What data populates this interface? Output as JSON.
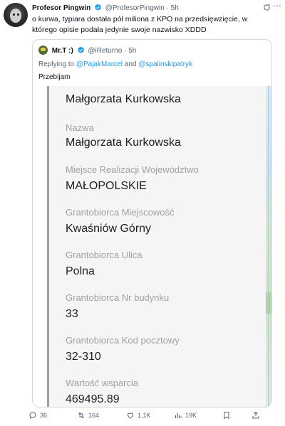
{
  "author": {
    "name": "Profesor Pingwin",
    "handle": "@ProfesorPingwin",
    "dot": "·",
    "time": "5h"
  },
  "tweet_text": "o kurwa, typiara dostała pół miliona z KPO na przedsięwzięcie, w którego opisie podała jedynie swoje nazwisko XDDD",
  "quote": {
    "name": "Mr.T :)",
    "handle": "@iReturno",
    "dot": "·",
    "time": "5h",
    "reply_prefix": "Replying to ",
    "mention1": "@PajakMarcel",
    "reply_and": " and ",
    "mention2": "@spalinskipatryk",
    "text": "Przebijam",
    "image_fields": [
      {
        "label": "",
        "value": "Małgorzata Kurkowska"
      },
      {
        "label": "Nazwa",
        "value": "Małgorzata Kurkowska"
      },
      {
        "label": "Miejsce Realizacji Województwo",
        "value": "MAŁOPOLSKIE"
      },
      {
        "label": "Grantobiorca Miejscowość",
        "value": "Kwaśniów Górny"
      },
      {
        "label": "Grantobiorca Ulica",
        "value": "Polna"
      },
      {
        "label": "Grantobiorca Nr budynku",
        "value": "33"
      },
      {
        "label": "Grantobiorca Kod pocztowy",
        "value": "32-310"
      },
      {
        "label": "Wartość wsparcia",
        "value": "469495.89"
      }
    ]
  },
  "actions": {
    "replies": "36",
    "reposts": "164",
    "likes": "1,1K",
    "views": "19K"
  },
  "icons": [
    "verified-badge-icon",
    "grok-icon",
    "more-icon",
    "reply-icon",
    "repost-icon",
    "like-icon",
    "views-icon",
    "bookmark-icon",
    "share-icon"
  ],
  "colors": {
    "accent": "#1d9bf0",
    "muted": "#536471",
    "field_label": "#a0a0a0"
  }
}
